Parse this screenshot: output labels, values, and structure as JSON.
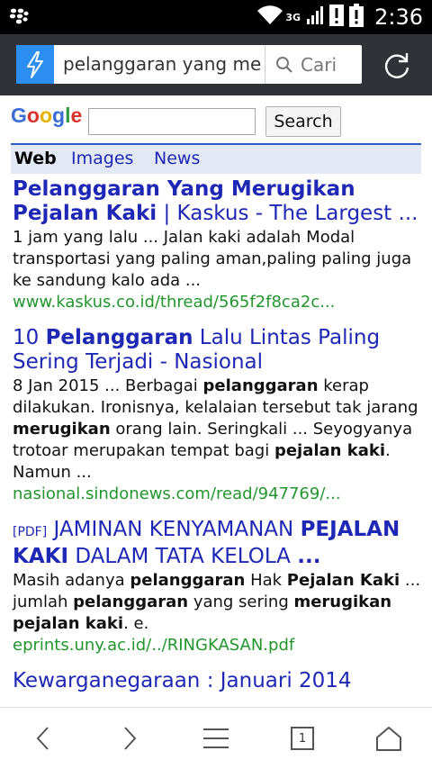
{
  "status_bar": {
    "network": "3G",
    "time": "2:36"
  },
  "browser": {
    "url_text": "pelanggaran yang me",
    "search_label": "Cari"
  },
  "google": {
    "logo_letters": [
      {
        "ch": "G",
        "color": "#3b6dd6"
      },
      {
        "ch": "o",
        "color": "#d8332a"
      },
      {
        "ch": "o",
        "color": "#e6b400"
      },
      {
        "ch": "g",
        "color": "#3b6dd6"
      },
      {
        "ch": "l",
        "color": "#2e9a3e"
      },
      {
        "ch": "e",
        "color": "#d8332a"
      }
    ],
    "search_value": "",
    "search_button": "Search",
    "tabs": [
      "Web",
      "Images",
      "News"
    ]
  },
  "results": [
    {
      "title_html": "<b>Pelanggaran Yang Merugikan Pejalan Kaki</b> | Kaskus - The Largest ...",
      "snippet_html": "1 jam yang lalu ... Jalan kaki adalah Modal transportasi yang paling aman,paling paling juga ke sandung kalo ada ...",
      "url": "www.kaskus.co.id/thread/565f2f8ca2c..."
    },
    {
      "title_html": "10 <b>Pelanggaran</b> Lalu Lintas Paling Sering Terjadi - Nasional",
      "snippet_html": "8 Jan 2015 ... Berbagai <b>pelanggaran</b> kerap dilakukan. Ironisnya, kelalaian tersebut tak jarang <b>merugikan</b> orang lain. Seringkali ... Seyogyanya trotoar merupakan tempat bagi <b>pejalan kaki</b>. Namun ...",
      "url": "nasional.sindonews.com/read/947769/..."
    },
    {
      "title_html": "<span class=\"pdf\">[PDF]</span> JAMINAN KENYAMANAN <b>PEJALAN KAKI</b> DALAM TATA KELOLA <b>...</b>",
      "snippet_html": "Masih adanya <b>pelanggaran</b> Hak <b>Pejalan Kaki</b> ... jumlah <b>pelanggaran</b> yang sering <b>merugikan pejalan kaki</b>. e.",
      "url": "eprints.uny.ac.id/../RINGKASAN.pdf"
    },
    {
      "title_html": "Kewarganegaraan : Januari 2014",
      "snippet_html": "",
      "url": ""
    }
  ],
  "bottom_nav": {
    "tab_count": "1"
  },
  "colors": {
    "link": "#1f27b5",
    "url_green": "#22962d",
    "toolbar": "#2f3236",
    "badge": "#2c8ef0"
  }
}
